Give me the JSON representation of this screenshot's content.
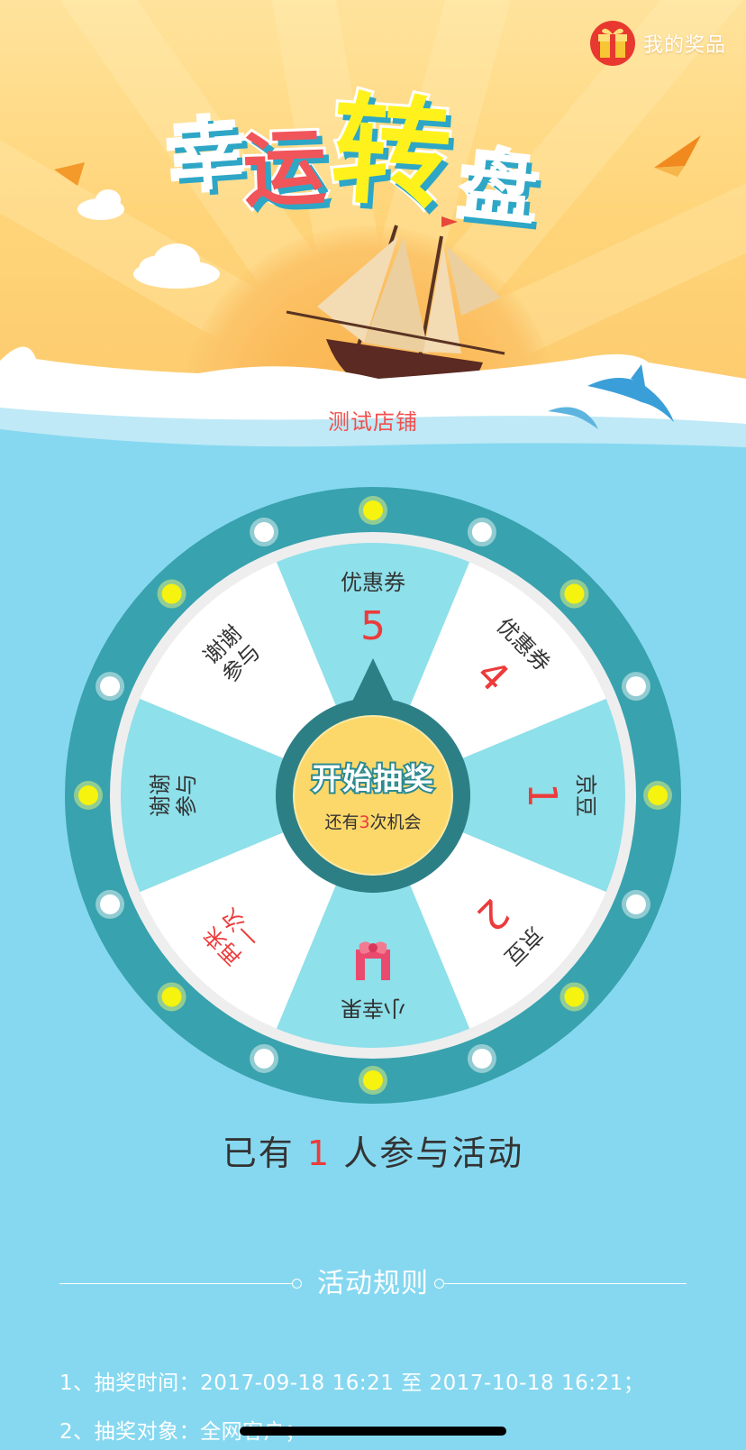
{
  "header": {
    "my_prizes_label": "我的奖品",
    "gift_icon": "gift-icon"
  },
  "hero": {
    "title_chars": [
      "幸",
      "运",
      "转",
      "盘"
    ],
    "title_colors": [
      "#ffffff",
      "#f0555a",
      "#fff21c",
      "#ffffff"
    ],
    "shop_name": "测试店铺"
  },
  "wheel": {
    "segments": [
      {
        "label": "优惠券",
        "number": "5",
        "fill": "#8ee0ea"
      },
      {
        "label": "优惠券",
        "number": "4",
        "fill": "#ffffff"
      },
      {
        "label": "京豆",
        "number": "1",
        "fill": "#8ee0ea"
      },
      {
        "label": "京豆",
        "number": "2",
        "fill": "#ffffff"
      },
      {
        "label": "小幸果",
        "number": "",
        "icon": "ribbon-gift-icon",
        "fill": "#8ee0ea"
      },
      {
        "label": "再来一次",
        "number": "",
        "fill": "#ffffff",
        "red": true
      },
      {
        "label": "谢谢参与",
        "number": "",
        "fill": "#8ee0ea"
      },
      {
        "label": "谢谢参与",
        "number": "",
        "fill": "#ffffff"
      }
    ],
    "lights": [
      "yellow",
      "white",
      "yellow",
      "white",
      "yellow",
      "white",
      "yellow",
      "white",
      "yellow",
      "white",
      "yellow",
      "white",
      "yellow",
      "white",
      "yellow",
      "white"
    ],
    "start_button": {
      "title": "开始抽奖",
      "remaining_prefix": "还有",
      "remaining_count": "3",
      "remaining_suffix": "次机会"
    },
    "colors": {
      "outer_ring": "#38a2ae",
      "rim": "#eeeeee",
      "hub": "#2d7f86",
      "button": "#fcd86a"
    }
  },
  "stats": {
    "prefix": "已有",
    "count": "1",
    "suffix": "人参与活动"
  },
  "rules": {
    "title": "活动规则",
    "items": [
      "1、抽奖时间：2017-09-18 16:21 至 2017-10-18 16:21；",
      "2、抽奖对象：全网客户；"
    ]
  }
}
